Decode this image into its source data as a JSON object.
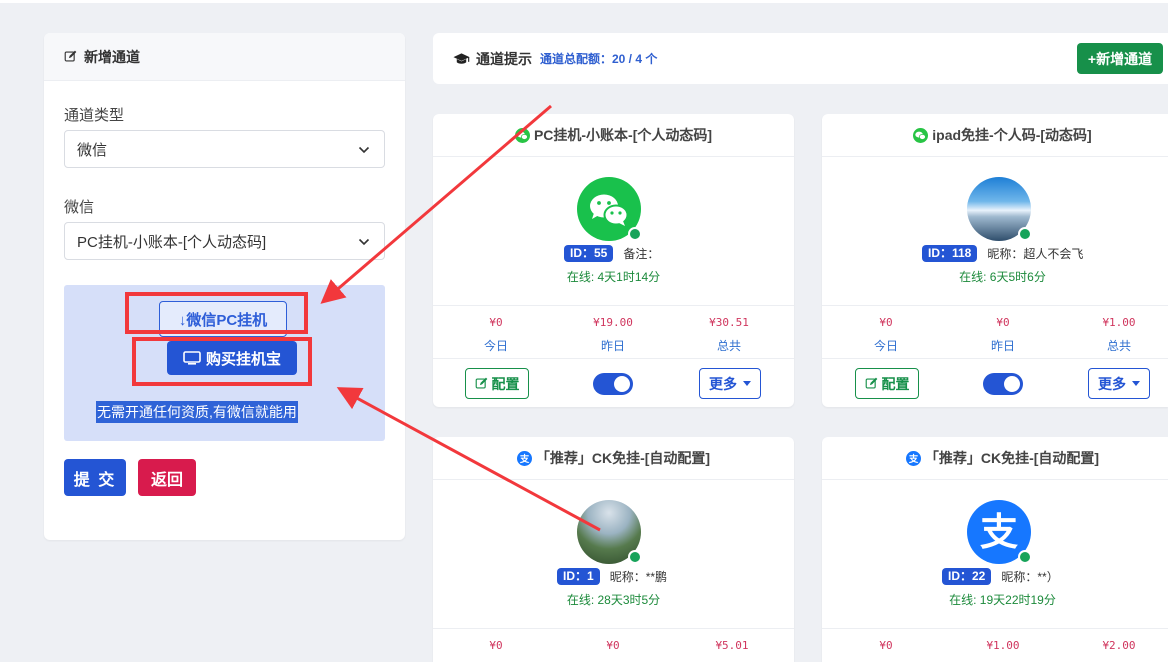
{
  "left": {
    "title": "新增通道",
    "type_label": "通道类型",
    "type_value": "微信",
    "sub_label": "微信",
    "sub_value": "PC挂机-小账本-[个人动态码]",
    "download_button": "↓微信PC挂机",
    "buy_button": "购买挂机宝",
    "hint": "无需开通任何资质,有微信就能用",
    "submit": "提 交",
    "back": "返回"
  },
  "header": {
    "title": "通道提示",
    "quota": "通道总配额：20 / 4 个",
    "add_button": "+新增通道"
  },
  "stat_labels": [
    "今日",
    "昨日",
    "总共"
  ],
  "card_buttons": {
    "config": "配置",
    "more": "更多"
  },
  "cards": [
    {
      "title": "PC挂机-小账本-[个人动态码]",
      "id": "ID：55",
      "note": "备注：",
      "online": "在线: 4天1时14分",
      "stats": [
        "¥0",
        "¥19.00",
        "¥30.51"
      ]
    },
    {
      "title": "ipad免挂-个人码-[动态码]",
      "id": "ID：118",
      "note": "昵称：超人不会飞",
      "online": "在线: 6天5时6分",
      "stats": [
        "¥0",
        "¥0",
        "¥1.00"
      ]
    },
    {
      "title": "「推荐」CK免挂-[自动配置]",
      "id": "ID：1",
      "note": "昵称：**鹏",
      "online": "在线: 28天3时5分",
      "stats": [
        "¥0",
        "¥0",
        "¥5.01"
      ]
    },
    {
      "title": "「推荐」CK免挂-[自动配置]",
      "id": "ID：22",
      "note": "昵称：**）",
      "online": "在线: 19天22时19分",
      "stats": [
        "¥0",
        "¥1.00",
        "¥2.00"
      ]
    }
  ],
  "colors": {
    "primary": "#2455d4",
    "success": "#17904a",
    "danger": "#d81b4d",
    "annotation": "#f2383c"
  }
}
